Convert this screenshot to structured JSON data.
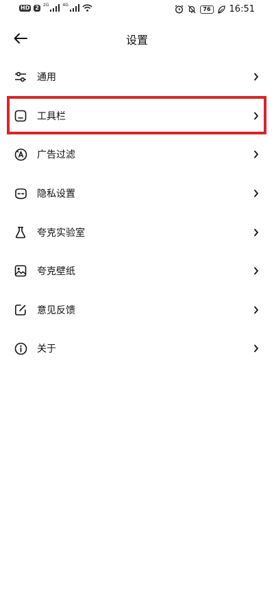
{
  "status_bar": {
    "hd_badge": "HD",
    "hd_number": "2",
    "signal1_tag": "2G",
    "signal2_tag": "4G",
    "battery": "76",
    "time": "16:51"
  },
  "header": {
    "title": "设置"
  },
  "menu": {
    "items": [
      {
        "label": "通用",
        "icon": "sliders-icon"
      },
      {
        "label": "工具栏",
        "icon": "toolbar-icon"
      },
      {
        "label": "广告过滤",
        "icon": "ad-filter-icon"
      },
      {
        "label": "隐私设置",
        "icon": "privacy-mask-icon"
      },
      {
        "label": "夸克实验室",
        "icon": "flask-icon"
      },
      {
        "label": "夸克壁纸",
        "icon": "wallpaper-image-icon"
      },
      {
        "label": "意见反馈",
        "icon": "feedback-edit-icon"
      },
      {
        "label": "关于",
        "icon": "info-icon"
      }
    ]
  },
  "colors": {
    "highlight_border": "#d9242b",
    "text": "#111111",
    "background": "#ffffff"
  }
}
